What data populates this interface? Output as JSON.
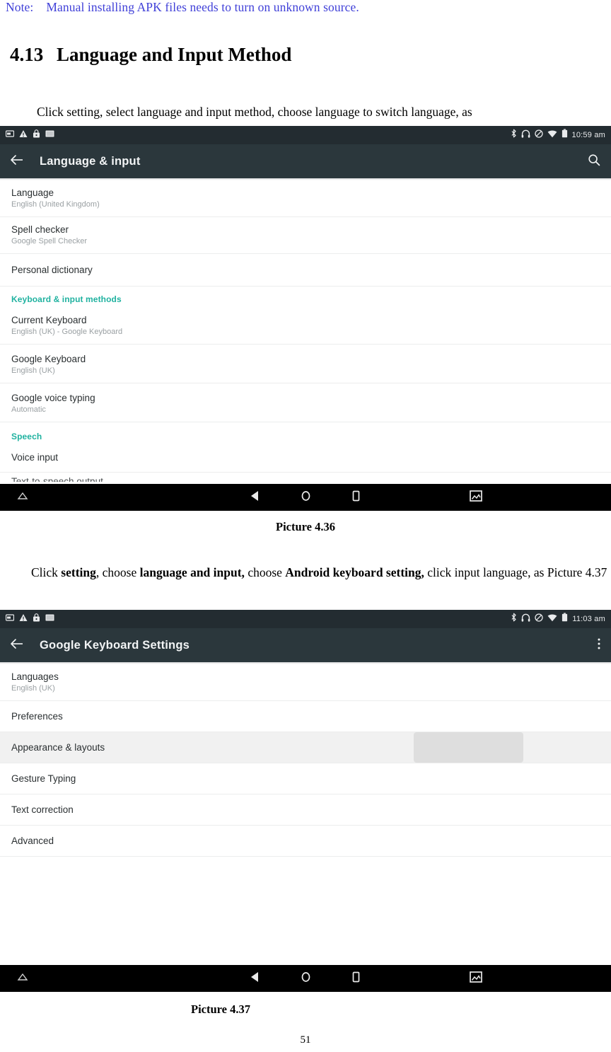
{
  "document": {
    "note": {
      "label": "Note:",
      "text": "Manual installing APK files needs to turn on unknown source."
    },
    "heading": {
      "number": "4.13",
      "title": "Language and Input Method"
    },
    "paragraph_1": "Click setting, select language and input method, choose language to switch language, as",
    "paragraph_2": {
      "part_1": "Click ",
      "bold_1": "setting",
      "part_2": ", choose ",
      "bold_2": "language and input,",
      "part_3": " choose ",
      "bold_3": "Android keyboard setting,",
      "part_4": " click input language, as Picture 4.37"
    },
    "caption_1": "Picture 4.36",
    "caption_2": "Picture 4.37",
    "page_number": "51"
  },
  "screenshot_1": {
    "statusbar": {
      "time": "10:59 am",
      "left_icons": [
        "sd-card-icon",
        "warning-triangle-icon",
        "usb-lock-icon",
        "screenshot-icon"
      ],
      "right_icons": [
        "bluetooth-icon",
        "headset-icon",
        "do-not-disturb-icon",
        "wifi-icon",
        "battery-icon"
      ]
    },
    "toolbar": {
      "back_icon": "arrow-back-icon",
      "title": "Language & input",
      "action_icon": "search-icon"
    },
    "rows": [
      {
        "title": "Language",
        "subtitle": "English (United Kingdom)",
        "type": "item"
      },
      {
        "title": "Spell checker",
        "subtitle": "Google Spell Checker",
        "type": "item"
      },
      {
        "title": "Personal dictionary",
        "subtitle": "",
        "type": "item"
      },
      {
        "title": "Keyboard & input methods",
        "subtitle": "",
        "type": "section"
      },
      {
        "title": "Current Keyboard",
        "subtitle": "English (UK) - Google Keyboard",
        "type": "item"
      },
      {
        "title": "Google Keyboard",
        "subtitle": "English (UK)",
        "type": "item"
      },
      {
        "title": "Google voice typing",
        "subtitle": "Automatic",
        "type": "item"
      },
      {
        "title": "Speech",
        "subtitle": "",
        "type": "section"
      },
      {
        "title": "Voice input",
        "subtitle": "",
        "type": "item"
      },
      {
        "title": "Text-to-speech output",
        "subtitle": "",
        "type": "clipped"
      }
    ],
    "navbar": {
      "icons": [
        "home-up-icon",
        "back-icon",
        "home-circle-icon",
        "recents-icon",
        "screenshot-icon"
      ]
    }
  },
  "screenshot_2": {
    "statusbar": {
      "time": "11:03 am",
      "left_icons": [
        "sd-card-icon",
        "warning-triangle-icon",
        "usb-lock-icon",
        "screenshot-icon"
      ],
      "right_icons": [
        "bluetooth-icon",
        "headset-icon",
        "do-not-disturb-icon",
        "wifi-icon",
        "battery-icon"
      ]
    },
    "toolbar": {
      "back_icon": "arrow-back-icon",
      "title": "Google Keyboard Settings",
      "action_icon": "overflow-menu-icon"
    },
    "rows": [
      {
        "title": "Languages",
        "subtitle": "English (UK)",
        "type": "item",
        "pressed": false
      },
      {
        "title": "Preferences",
        "subtitle": "",
        "type": "item",
        "pressed": false
      },
      {
        "title": "Appearance & layouts",
        "subtitle": "",
        "type": "item",
        "pressed": true
      },
      {
        "title": "Gesture Typing",
        "subtitle": "",
        "type": "item",
        "pressed": false
      },
      {
        "title": "Text correction",
        "subtitle": "",
        "type": "item",
        "pressed": false
      },
      {
        "title": "Advanced",
        "subtitle": "",
        "type": "item",
        "pressed": false
      }
    ],
    "navbar": {
      "icons": [
        "home-up-icon",
        "back-icon",
        "home-circle-icon",
        "recents-icon",
        "screenshot-icon"
      ]
    }
  },
  "colors": {
    "note_blue": "#4040d8",
    "statusbar_bg": "#232c31",
    "toolbar_bg": "#2b373c",
    "section_accent": "#20b2a0",
    "navbar_bg": "#000000",
    "row_pressed": "#f1f1f1"
  }
}
